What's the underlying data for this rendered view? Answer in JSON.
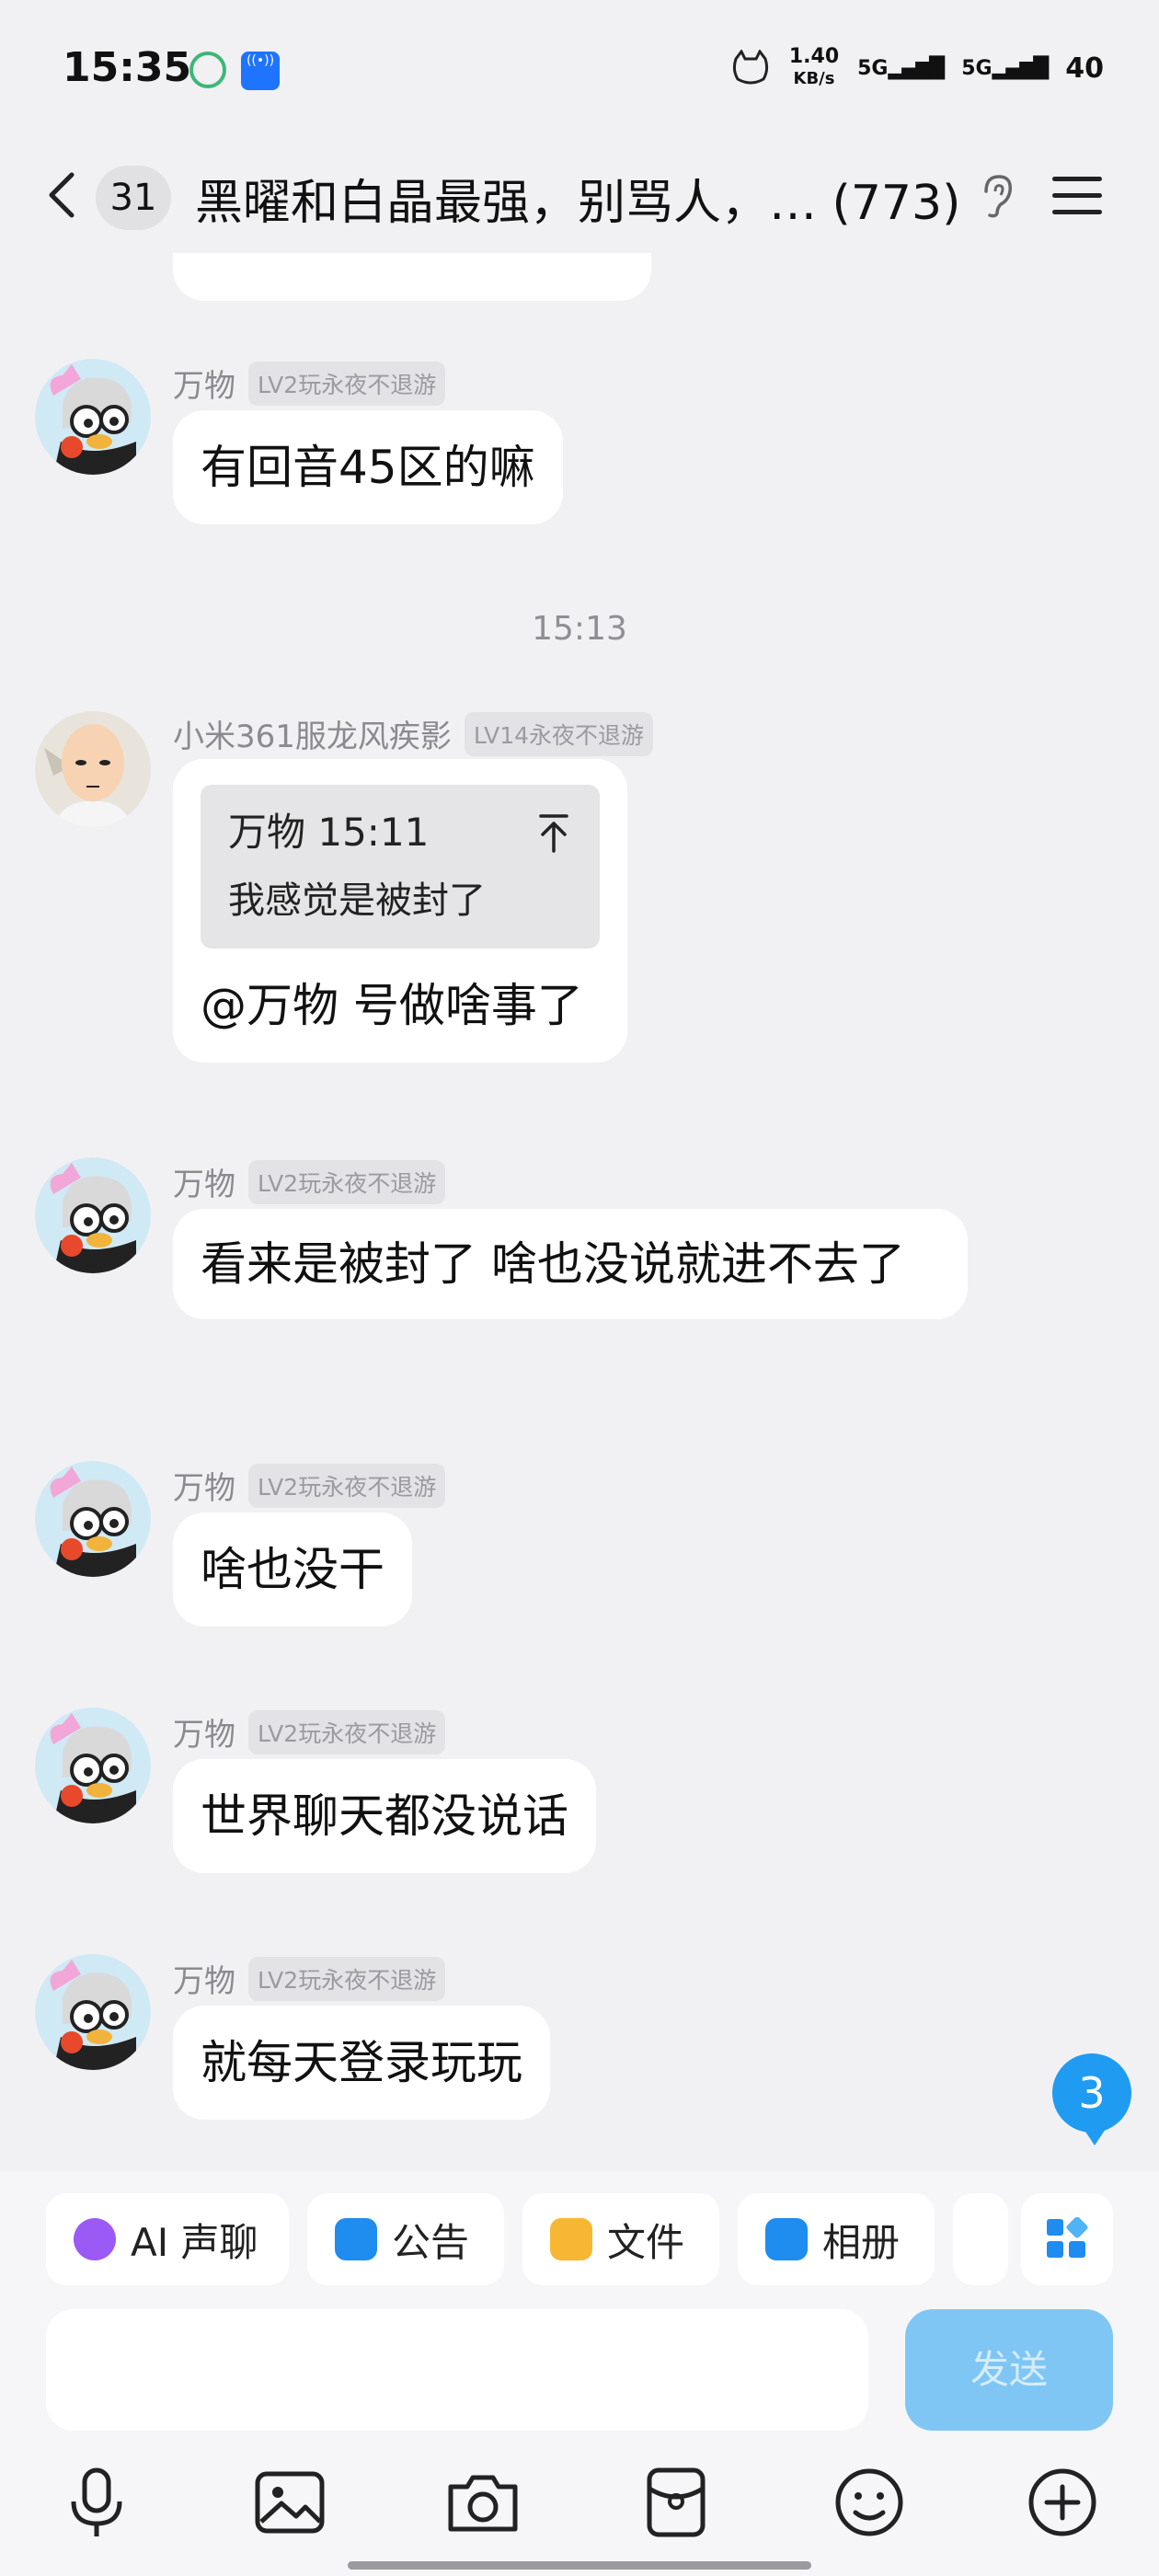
{
  "status_bar": {
    "time": "15:35",
    "net_speed_value": "1.40",
    "net_speed_unit": "KB/s",
    "sim1": "5G",
    "sim2": "5G",
    "battery": "40"
  },
  "header": {
    "unread_count": "31",
    "title": "黑曜和白晶最强，别骂人，… (773)"
  },
  "messages": [
    {
      "name": "万物",
      "badge": "LV2玩永夜不退游",
      "text": "有回音45区的嘛"
    },
    {
      "time": "15:13"
    },
    {
      "name": "小米361服龙风疾影",
      "badge": "LV14永夜不退游",
      "quote_head": "万物 15:11",
      "quote_text": "我感觉是被封了",
      "text": "@万物 号做啥事了"
    },
    {
      "name": "万物",
      "badge": "LV2玩永夜不退游",
      "text": "看来是被封了 啥也没说就进不去了"
    },
    {
      "name": "万物",
      "badge": "LV2玩永夜不退游",
      "text": "啥也没干"
    },
    {
      "name": "万物",
      "badge": "LV2玩永夜不退游",
      "text": "世界聊天都没说话"
    },
    {
      "name": "万物",
      "badge": "LV2玩永夜不退游",
      "text": "就每天登录玩玩"
    }
  ],
  "new_message_count": "3",
  "quick_actions": [
    {
      "label": "AI 声聊",
      "icon": "ai-voice-icon"
    },
    {
      "label": "公告",
      "icon": "announcement-icon"
    },
    {
      "label": "文件",
      "icon": "folder-icon"
    },
    {
      "label": "相册",
      "icon": "album-icon"
    }
  ],
  "send_label": "发送",
  "toolbar_icons": [
    "microphone-icon",
    "image-icon",
    "camera-icon",
    "red-packet-icon",
    "emoji-icon",
    "plus-icon"
  ],
  "colors": {
    "accent": "#1f9bf2",
    "send_disabled": "#7fc6f5",
    "background": "#f1f1f3"
  }
}
